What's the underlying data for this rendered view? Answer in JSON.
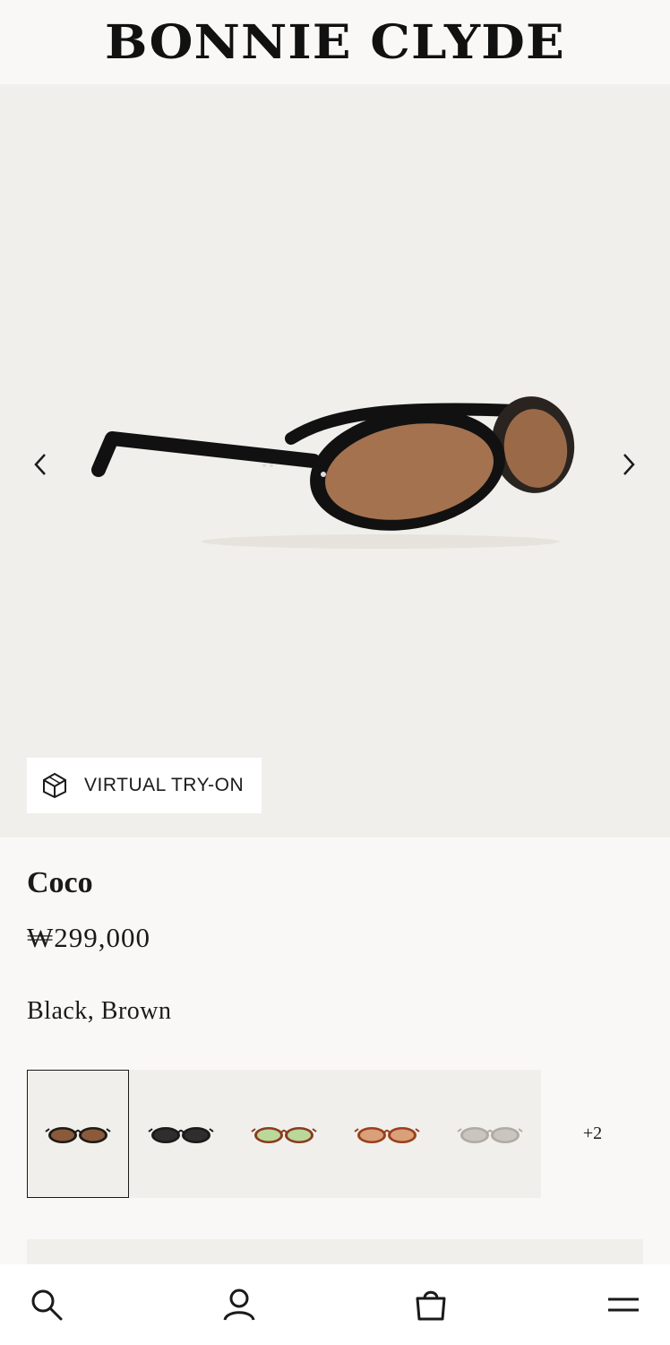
{
  "brand": {
    "logo_text": "BONNIE CLYDE"
  },
  "gallery": {
    "prev_icon": "chevron-left-icon",
    "next_icon": "chevron-right-icon",
    "virtual_try_on_label": "VIRTUAL TRY-ON",
    "virtual_try_on_icon": "cube-icon"
  },
  "product": {
    "name": "Coco",
    "price": "₩299,000",
    "color_name": "Black, Brown"
  },
  "variants": {
    "items": [
      {
        "frame_color": "#1c1a18",
        "lens_color": "#8a5a3a",
        "selected": true
      },
      {
        "frame_color": "#1c1a18",
        "lens_color": "#2e2e2e",
        "selected": false
      },
      {
        "frame_color": "#8a3b1e",
        "lens_color": "#b9d89a",
        "selected": false
      },
      {
        "frame_color": "#9a3f1c",
        "lens_color": "#d9a07a",
        "selected": false
      },
      {
        "frame_color": "#b0aaa2",
        "lens_color": "#c9c6c0",
        "selected": false
      }
    ],
    "more_label": "+2"
  },
  "bottom_nav": {
    "items": [
      {
        "icon": "search-icon"
      },
      {
        "icon": "account-icon"
      },
      {
        "icon": "bag-icon"
      },
      {
        "icon": "menu-icon"
      }
    ]
  },
  "colors": {
    "background": "#f9f8f6",
    "image_bg": "#f1efeb",
    "text": "#1a1a1a"
  }
}
